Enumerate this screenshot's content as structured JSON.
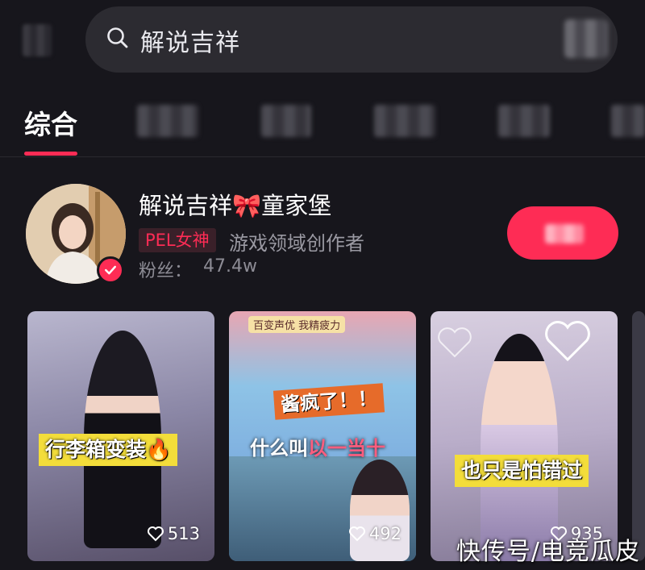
{
  "search": {
    "query": "解说吉祥",
    "icon": "search-icon"
  },
  "tabs": {
    "active": "综合"
  },
  "user": {
    "name": "解说吉祥🎀童家堡",
    "badge": "PEL女神",
    "role": "游戏领域创作者",
    "fans_label": "粉丝：",
    "fans_value": "47.4w"
  },
  "videos": [
    {
      "caption": "行李箱变装🔥",
      "likes": "513"
    },
    {
      "top_label": "百变声优  我精疲力",
      "tag": "酱疯了！！",
      "caption_pre": "什么叫",
      "caption_em": "以一当十",
      "likes": "492"
    },
    {
      "caption": "也只是怕错过",
      "likes": "935"
    }
  ],
  "watermark": "快传号/电竞瓜皮",
  "colors": {
    "accent": "#fe2c55",
    "background": "#17161c"
  }
}
